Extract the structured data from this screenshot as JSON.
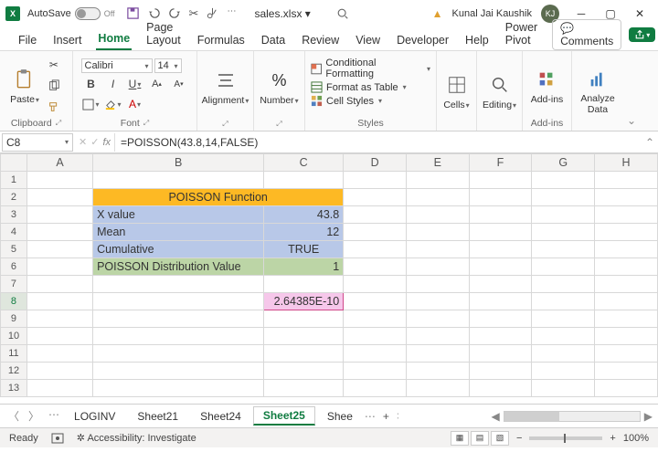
{
  "title": {
    "autosave": "AutoSave",
    "autosave_state": "Off",
    "filename": "sales.xlsx ▾",
    "user": "Kunal Jai Kaushik",
    "user_initials": "KJ"
  },
  "menu": {
    "file": "File",
    "insert": "Insert",
    "home": "Home",
    "page": "Page Layout",
    "formulas": "Formulas",
    "data": "Data",
    "review": "Review",
    "view": "View",
    "dev": "Developer",
    "help": "Help",
    "power": "Power Pivot",
    "comments": "Comments"
  },
  "ribbon": {
    "clipboard_label": "Clipboard",
    "paste": "Paste",
    "font_label": "Font",
    "font_name": "Calibri",
    "font_size": "14",
    "alignment_label": "Alignment",
    "alignment": "Alignment",
    "number_label": "Number",
    "number": "Number",
    "styles_label": "Styles",
    "cond": "Conditional Formatting",
    "table": "Format as Table",
    "cell": "Cell Styles",
    "cells": "Cells",
    "editing": "Editing",
    "addins": "Add-ins",
    "analyze": "Analyze Data",
    "addins_label": "Add-ins"
  },
  "fx": {
    "cellref": "C8",
    "formula": "=POISSON(43.8,14,FALSE)"
  },
  "cols": [
    "A",
    "B",
    "C",
    "D",
    "E",
    "F",
    "G",
    "H"
  ],
  "rows": [
    "1",
    "2",
    "3",
    "4",
    "5",
    "6",
    "7",
    "8",
    "9",
    "10",
    "11",
    "12",
    "13"
  ],
  "cells": {
    "b2": "POISSON Function",
    "b3": "X value",
    "c3": "43.8",
    "b4": "Mean",
    "c4": "12",
    "b5": "Cumulative",
    "c5": "TRUE",
    "b6": "POISSON Distribution Value",
    "c6": "1",
    "c8": "2.64385E-10"
  },
  "tabs": {
    "loginv": "LOGINV",
    "s21": "Sheet21",
    "s24": "Sheet24",
    "s25": "Sheet25",
    "shee": "Shee"
  },
  "status": {
    "ready": "Ready",
    "acc": "Accessibility: Investigate",
    "zoom": "100%"
  },
  "chart_data": {
    "type": "table",
    "title": "POISSON Function",
    "rows": [
      {
        "label": "X value",
        "value": 43.8
      },
      {
        "label": "Mean",
        "value": 12
      },
      {
        "label": "Cumulative",
        "value": "TRUE"
      },
      {
        "label": "POISSON Distribution Value",
        "value": 1
      }
    ],
    "result_cell": "2.64385E-10",
    "formula": "=POISSON(43.8,14,FALSE)"
  }
}
